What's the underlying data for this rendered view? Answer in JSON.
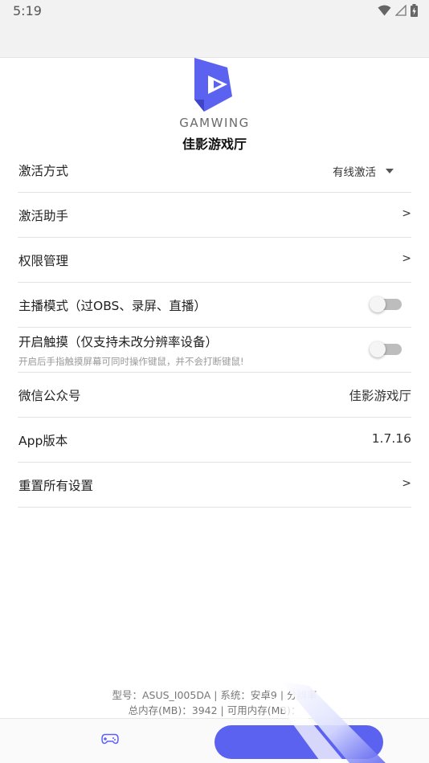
{
  "status_bar": {
    "time": "5:19",
    "icons": [
      "wifi-icon",
      "signal-icon",
      "battery-charging-icon"
    ]
  },
  "logo": {
    "text": "GAMWING",
    "app_name": "佳影游戏厅",
    "brand_color": "#5c62f0"
  },
  "settings": {
    "activation_mode": {
      "label": "激活方式",
      "value": "有线激活"
    },
    "activation_helper": {
      "label": "激活助手",
      "chevron": ">"
    },
    "permission_manage": {
      "label": "权限管理",
      "chevron": ">"
    },
    "streamer_mode": {
      "label": "主播模式（过OBS、录屏、直播）",
      "enabled": false
    },
    "touch_enable": {
      "label": "开启触摸（仅支持未改分辨率设备）",
      "sub": "开启后手指触摸屏幕可同时操作键鼠，并不会打断键鼠!",
      "enabled": false
    },
    "wechat": {
      "label": "微信公众号",
      "value": "佳影游戏厅"
    },
    "app_version": {
      "label": "App版本",
      "value": "1.7.16"
    },
    "reset": {
      "label": "重置所有设置",
      "chevron": ">"
    }
  },
  "device_info": {
    "line1": "型号：ASUS_I005DA | 系统：安卓9 | 分辨率",
    "line2": "总内存(MB)：3942 | 可用内存(MB)："
  },
  "bottom_nav": {
    "icons": [
      "gamepad-icon"
    ]
  }
}
